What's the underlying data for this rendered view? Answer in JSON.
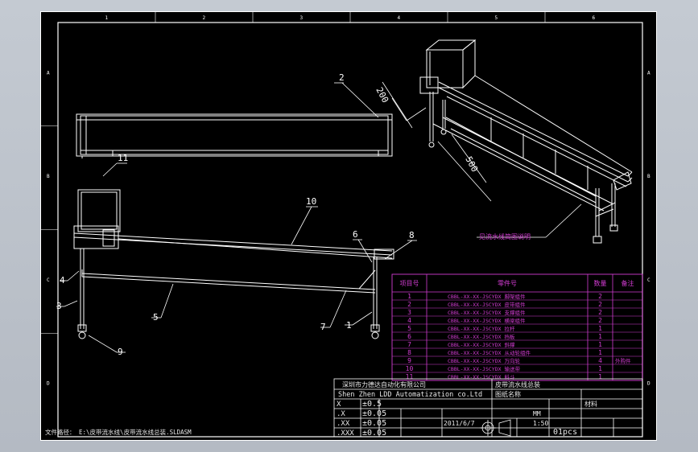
{
  "colors": {
    "background": "#bfc5cd",
    "sheet": "#000000",
    "line": "#ffffff",
    "annotation": "#d23cd2",
    "title_text": "#e8e8e8"
  },
  "grid": {
    "columns": [
      "1",
      "2",
      "3",
      "4",
      "5",
      "6"
    ],
    "rows": [
      "A",
      "B",
      "C",
      "D"
    ]
  },
  "callouts": [
    {
      "label": "1"
    },
    {
      "label": "2"
    },
    {
      "label": "3"
    },
    {
      "label": "4"
    },
    {
      "label": "5"
    },
    {
      "label": "6"
    },
    {
      "label": "7"
    },
    {
      "label": "8"
    },
    {
      "label": "9"
    },
    {
      "label": "10"
    },
    {
      "label": "11"
    }
  ],
  "dimensions": {
    "height_200": "200",
    "width_500": "500"
  },
  "iso_note": "见流水线简图说明",
  "bom": {
    "headers": [
      "项目号",
      "零件号",
      "数量",
      "备注"
    ],
    "rows": [
      {
        "item": "1",
        "part": "CBBL-XX-XX-JSCYDX 脚架组件",
        "qty": "2",
        "note": ""
      },
      {
        "item": "2",
        "part": "CBBL-XX-XX-JSCYDX 皮带组件",
        "qty": "2",
        "note": ""
      },
      {
        "item": "3",
        "part": "CBBL-XX-XX-JSCYDX 支撑组件",
        "qty": "2",
        "note": ""
      },
      {
        "item": "4",
        "part": "CBBL-XX-XX-JSCYDX 横梁组件",
        "qty": "2",
        "note": ""
      },
      {
        "item": "5",
        "part": "CBBL-XX-XX-JSCYDX 拉杆",
        "qty": "1",
        "note": ""
      },
      {
        "item": "6",
        "part": "CBBL-XX-XX-JSCYDX 挡板",
        "qty": "1",
        "note": ""
      },
      {
        "item": "7",
        "part": "CBBL-XX-XX-JSCYDX 斜撑",
        "qty": "1",
        "note": ""
      },
      {
        "item": "8",
        "part": "CBBL-XX-XX-JSCYDX 从动轮组件",
        "qty": "1",
        "note": ""
      },
      {
        "item": "9",
        "part": "CBBL-XX-XX-JSCYDX 万向轮",
        "qty": "4",
        "note": "外购件"
      },
      {
        "item": "10",
        "part": "CBBL-XX-XX-JSCYDX 输送带",
        "qty": "1",
        "note": ""
      },
      {
        "item": "11",
        "part": "CBBL-XX-XX-JSCYDX 料斗",
        "qty": "1",
        "note": ""
      }
    ]
  },
  "title_block": {
    "company_cn": "深圳市力德达自动化有限公司",
    "company_en": "Shen Zhen LDD Automatization co.Ltd",
    "product_name": "皮带流水线总装",
    "drawing_title": "图纸名称",
    "material_label": "材料",
    "date": "2011/6/7",
    "scale": "1:50",
    "units": "MM",
    "quantity": "01pcs",
    "tolerances": [
      {
        "label": "X",
        "value": "±0.5"
      },
      {
        "label": ".X",
        "value": "±0.05"
      },
      {
        "label": ".XX",
        "value": "±0.05"
      },
      {
        "label": ".XXX",
        "value": "±0.05"
      }
    ]
  },
  "file_path": "文件路径： E:\\皮带流水线\\皮带流水线总装.SLDASM"
}
